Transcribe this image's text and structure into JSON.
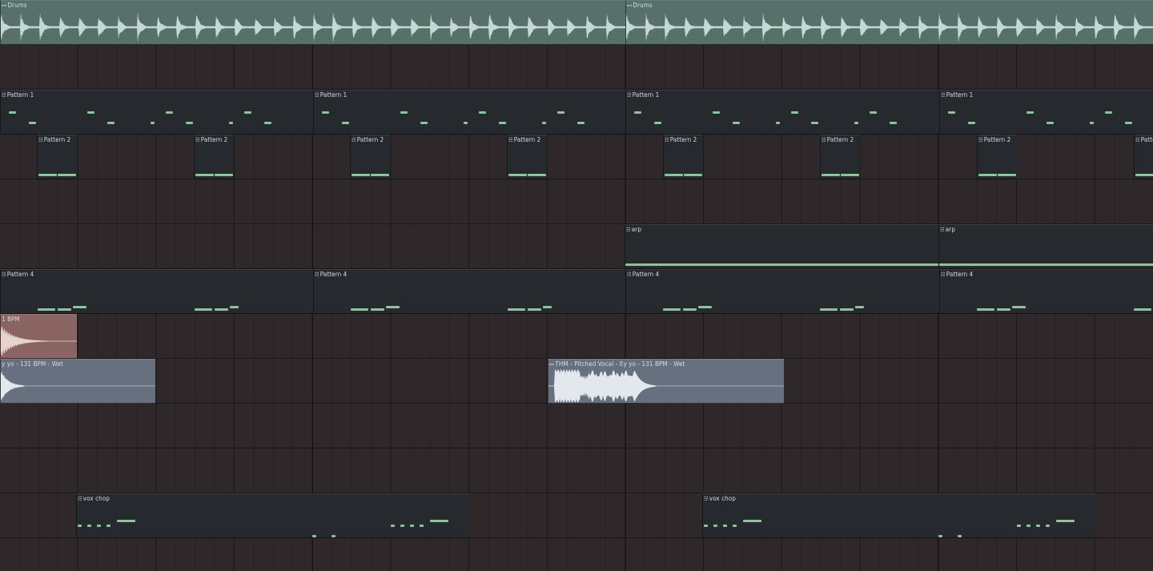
{
  "playlist": {
    "track_labels": {
      "drums": "Drums",
      "pattern_1": "Pattern 1",
      "pattern_2": "Pattern 2",
      "arp": "arp",
      "pattern_4": "Pattern 4",
      "perc_fragment": "1 BPM",
      "vocal_fragment": "y yo - 131 BPM - Wet",
      "vocal_full": "THM - Pitched Vocal - Ey yo - 131 BPM - Wet",
      "vox_chop": "vox chop"
    },
    "icons": {
      "audio_clip": "audio-clip-icon",
      "pattern_clip": "pattern-clip-icon"
    },
    "colors": {
      "background": "#2e282b",
      "pattern_clip": "#262a2f",
      "note": "#8fc49a",
      "drums_clip": "#577069",
      "vocal_clip": "#66707f",
      "perc_clip": "#8a6460"
    }
  }
}
